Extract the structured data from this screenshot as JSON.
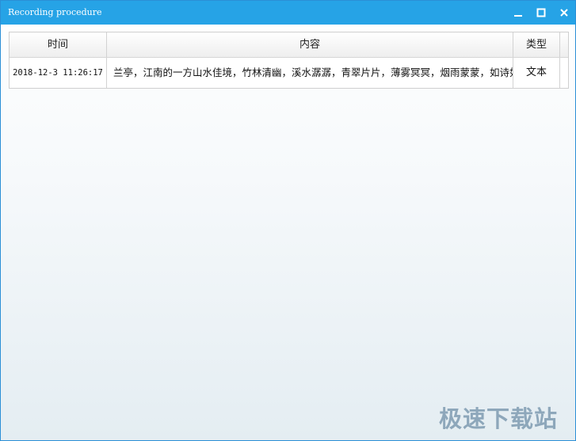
{
  "window": {
    "title": "Recording procedure",
    "accent_color": "#26a3e6"
  },
  "controls": {
    "minimize_icon": "minimize-icon",
    "maximize_icon": "maximize-icon",
    "close_icon": "close-icon"
  },
  "table": {
    "columns": [
      "时间",
      "内容",
      "类型"
    ],
    "rows": [
      {
        "time": "2018-12-3 11:26:17",
        "content": "兰亭，江南的一方山水佳境，竹林清幽，溪水潺潺，青翠片片，薄雾冥冥，烟雨蒙蒙，如诗如",
        "type": "文本"
      }
    ]
  },
  "watermark": "极速下载站"
}
